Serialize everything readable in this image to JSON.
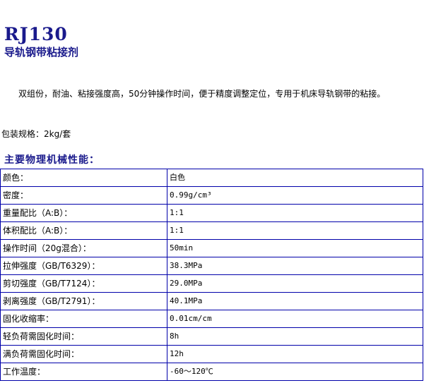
{
  "product": {
    "model": "RJ130",
    "name": "导轨钢带粘接剂",
    "description": "双组份，耐油、粘接强度高，50分钟操作时间，便于精度调整定位，专用于机床导轨钢带的粘接。",
    "packaging": "包装规格：2kg/套"
  },
  "properties": {
    "heading": "主要物理机械性能：",
    "rows": [
      {
        "label": "颜色：",
        "value": "白色"
      },
      {
        "label": "密度：",
        "value": "0.99g/cm³"
      },
      {
        "label": "重量配比（A:B）：",
        "value": " 1:1"
      },
      {
        "label": "体积配比（A:B）：",
        "value": " 1:1"
      },
      {
        "label": "操作时间（20g混合）：",
        "value": "50min"
      },
      {
        "label": "拉伸强度（GB/T6329）：",
        "value": "38.3MPa"
      },
      {
        "label": "剪切强度（GB/T7124）：",
        "value": "29.0MPa"
      },
      {
        "label": "剥离强度（GB/T2791）：",
        "value": "40.1MPa"
      },
      {
        "label": "固化收缩率：",
        "value": "0.01cm/cm"
      },
      {
        "label": "轻负荷需固化时间：",
        "value": "8h"
      },
      {
        "label": "满负荷需固化时间：",
        "value": "12h"
      },
      {
        "label": "工作温度：",
        "value": "-60～120℃"
      }
    ]
  },
  "colors": {
    "heading": "#1a1a8c",
    "table_border": "#0000aa"
  }
}
